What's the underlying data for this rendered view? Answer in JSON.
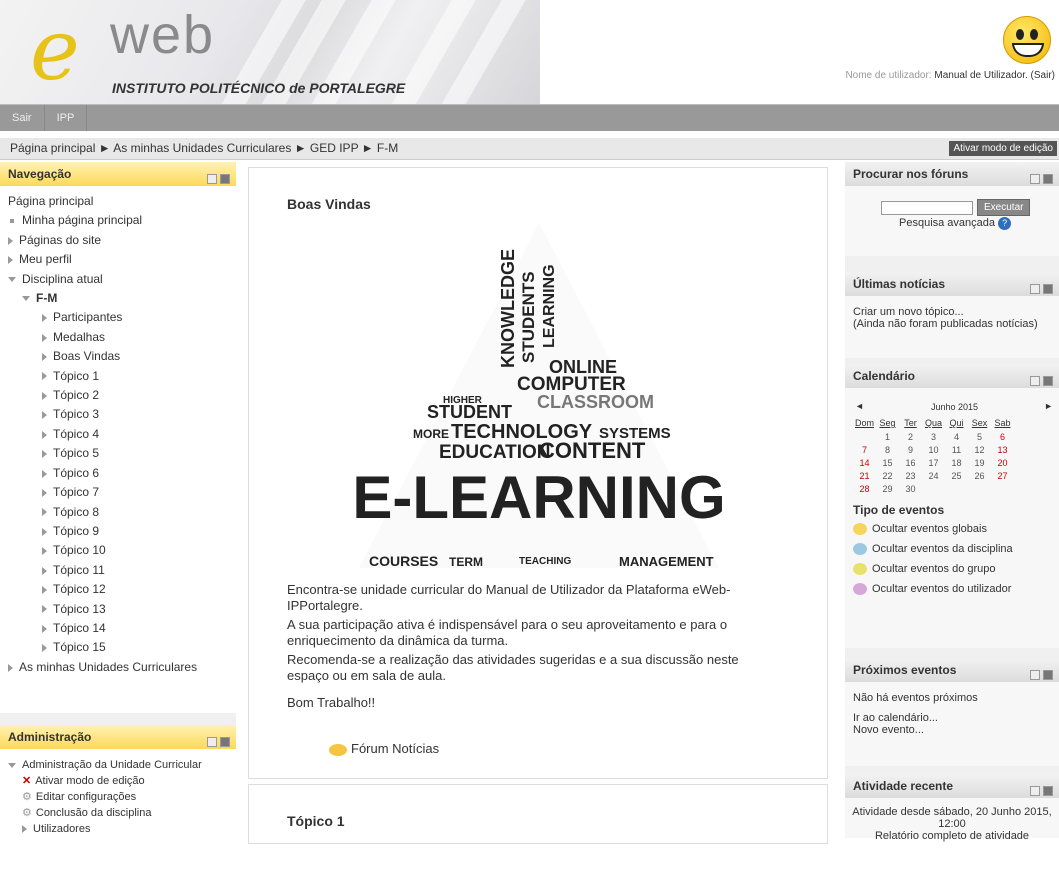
{
  "header": {
    "logo_letter": "e",
    "logo_word": "web",
    "logo_subtitle": "INSTITUTO POLITÉCNICO de PORTALEGRE",
    "user_prefix": "Nome de utilizador:",
    "user_name": "Manual de Utilizador.",
    "logout": "(Sair)"
  },
  "navbar": {
    "items": [
      "Sair",
      "IPP"
    ]
  },
  "breadcrumb": {
    "text": "Página principal ► As minhas Unidades Curriculares ► GED IPP ► F-M",
    "edit_button": "Ativar modo de edição"
  },
  "navigation": {
    "title": "Navegação",
    "home": "Página principal",
    "items": [
      "Minha página principal",
      "Páginas do site",
      "Meu perfil",
      "Disciplina atual"
    ],
    "course": "F-M",
    "course_items": [
      "Participantes",
      "Medalhas",
      "Boas Vindas",
      "Tópico 1",
      "Tópico 2",
      "Tópico 3",
      "Tópico 4",
      "Tópico 5",
      "Tópico 6",
      "Tópico 7",
      "Tópico 8",
      "Tópico 9",
      "Tópico 10",
      "Tópico 11",
      "Tópico 12",
      "Tópico 13",
      "Tópico 14",
      "Tópico 15"
    ],
    "my_courses": "As minhas Unidades Curriculares"
  },
  "administration": {
    "title": "Administração",
    "root": "Administração da Unidade Curricular",
    "items": [
      "Ativar modo de edição",
      "Editar configurações",
      "Conclusão da disciplina",
      "Utilizadores"
    ]
  },
  "main": {
    "welcome_title": "Boas Vindas",
    "word_cloud": {
      "w1": "E-LEARNING",
      "w2": "EDUCATION",
      "w3": "CONTENT",
      "w4": "TECHNOLOGY",
      "w5": "STUDENT",
      "w6": "CLASSROOM",
      "w7": "COMPUTER",
      "w8": "ONLINE",
      "w9": "COURSES",
      "w10": "TERM",
      "w11": "MANAGEMENT",
      "w12": "TEACHING",
      "w13": "KNOWLEDGE",
      "w14": "STUDENTS",
      "w15": "LEARNING",
      "w16": "SYSTEMS",
      "w17": "MORE",
      "w18": "HIGHER"
    },
    "p1": "Encontra-se unidade curricular do Manual de Utilizador da Plataforma eWeb-IPPortalegre.",
    "p2": "A sua participação ativa é indispensável para o seu aproveitamento e para o enriquecimento da dinâmica da turma.",
    "p3": "Recomenda-se a realização das atividades sugeridas e a sua discussão neste espaço ou em sala de aula.",
    "p4": "Bom Trabalho!!",
    "forum": "Fórum Notícias",
    "topic1": "Tópico 1"
  },
  "search_forums": {
    "title": "Procurar nos fóruns",
    "button": "Executar",
    "advanced": "Pesquisa avançada"
  },
  "news": {
    "title": "Últimas notícias",
    "create": "Criar um novo tópico...",
    "none": "(Ainda não foram publicadas notícias)"
  },
  "calendar": {
    "title": "Calendário",
    "month": "Junho 2015",
    "days": [
      "Dom",
      "Seg",
      "Ter",
      "Qua",
      "Qui",
      "Sex",
      "Sab"
    ],
    "weeks": [
      [
        "",
        "1",
        "2",
        "3",
        "4",
        "5",
        "6"
      ],
      [
        "7",
        "8",
        "9",
        "10",
        "11",
        "12",
        "13"
      ],
      [
        "14",
        "15",
        "16",
        "17",
        "18",
        "19",
        "20"
      ],
      [
        "21",
        "22",
        "23",
        "24",
        "25",
        "26",
        "27"
      ],
      [
        "28",
        "29",
        "30",
        "",
        "",
        "",
        ""
      ]
    ],
    "event_types_title": "Tipo de eventos",
    "events": [
      "Ocultar eventos globais",
      "Ocultar eventos da disciplina",
      "Ocultar eventos do grupo",
      "Ocultar eventos do utilizador"
    ],
    "event_colors": [
      "#f5d55b",
      "#9cc9e0",
      "#e9e26a",
      "#d6a8d8"
    ]
  },
  "upcoming": {
    "title": "Próximos eventos",
    "none": "Não há eventos próximos",
    "goto": "Ir ao calendário...",
    "new": "Novo evento..."
  },
  "recent": {
    "title": "Atividade recente",
    "since": "Atividade desde sábado, 20 Junho 2015,",
    "time": "12:00",
    "report": "Relatório completo de atividade"
  }
}
